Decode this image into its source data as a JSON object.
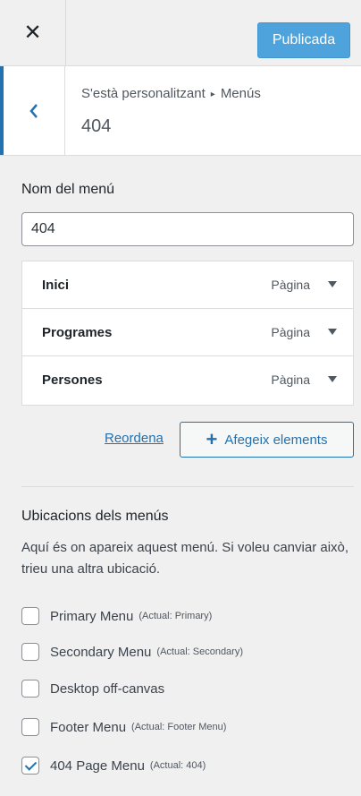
{
  "topbar": {
    "close_icon": "close-icon",
    "publish_label": "Publicada"
  },
  "header": {
    "breadcrumb_root": "S'està personalitzant",
    "breadcrumb_sep": "▸",
    "breadcrumb_section": "Menús",
    "title": "404"
  },
  "menu_name": {
    "label": "Nom del menú",
    "value": "404"
  },
  "menu_items": [
    {
      "title": "Inici",
      "type": "Pàgina"
    },
    {
      "title": "Programes",
      "type": "Pàgina"
    },
    {
      "title": "Persones",
      "type": "Pàgina"
    }
  ],
  "actions": {
    "reorder_label": "Reordena",
    "add_plus": "+",
    "add_label": "Afegeix elements"
  },
  "locations": {
    "title": "Ubicacions dels menús",
    "description": "Aquí és on apareix aquest menú. Si voleu canviar això, trieu una altra ubicació.",
    "items": [
      {
        "label": "Primary Menu",
        "current": "(Actual: Primary)",
        "checked": false
      },
      {
        "label": "Secondary Menu",
        "current": "(Actual: Secondary)",
        "checked": false
      },
      {
        "label": "Desktop off-canvas",
        "current": "",
        "checked": false
      },
      {
        "label": "Footer Menu",
        "current": "(Actual: Footer Menu)",
        "checked": false
      },
      {
        "label": "404 Page Menu",
        "current": "(Actual: 404)",
        "checked": true
      }
    ]
  },
  "colors": {
    "accent": "#2271b1",
    "publish_bg": "#4fa3dc",
    "panel_bg": "#f0f0f1"
  }
}
